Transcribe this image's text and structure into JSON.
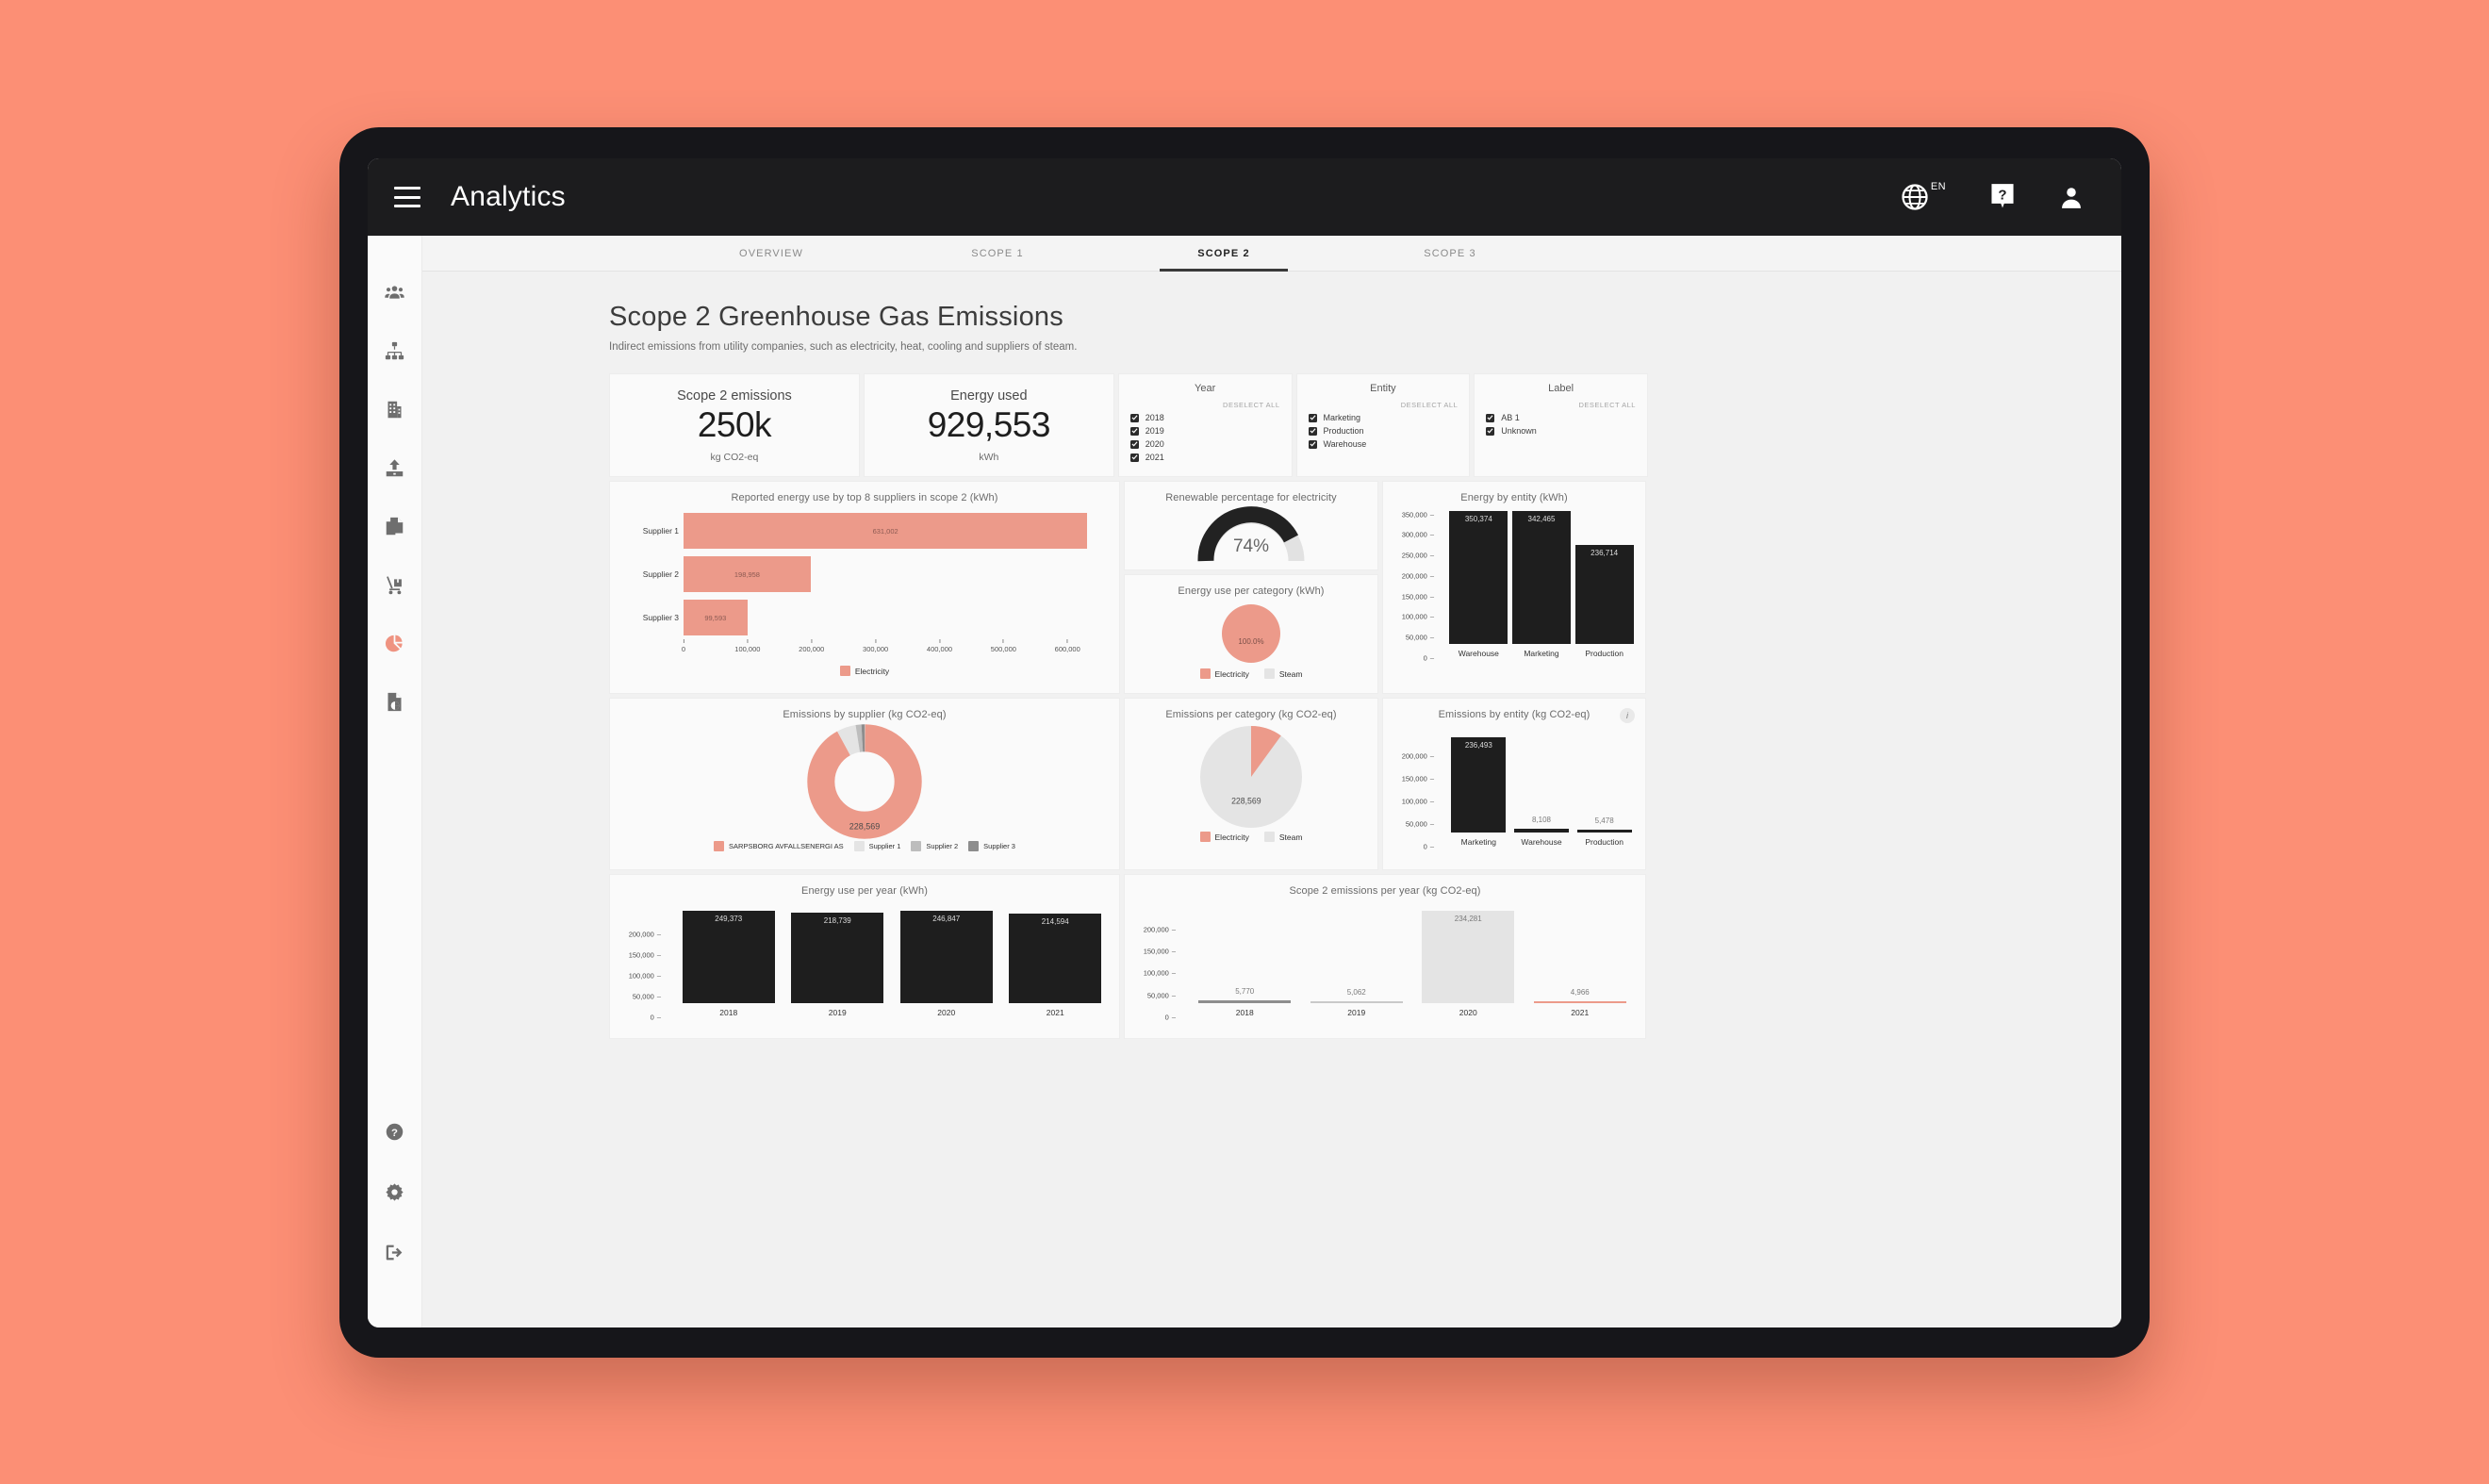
{
  "header": {
    "app_title": "Analytics",
    "lang_code": "EN",
    "menu_icon": "hamburger-icon",
    "globe_icon": "globe-icon",
    "help_icon": "help-bubble-icon",
    "account_icon": "user-avatar-icon"
  },
  "tabs": [
    {
      "label": "OVERVIEW",
      "active": false
    },
    {
      "label": "SCOPE 1",
      "active": false
    },
    {
      "label": "SCOPE 2",
      "active": true
    },
    {
      "label": "SCOPE 3",
      "active": false
    }
  ],
  "sidebar": {
    "top_items": [
      {
        "icon": "people-group-icon",
        "active": false
      },
      {
        "icon": "sitemap-icon",
        "active": false
      },
      {
        "icon": "building-icon",
        "active": false
      },
      {
        "icon": "upload-icon",
        "active": false
      },
      {
        "icon": "copy-documents-icon",
        "active": false
      },
      {
        "icon": "hand-truck-icon",
        "active": false
      },
      {
        "icon": "pie-chart-icon",
        "active": true
      },
      {
        "icon": "file-chart-icon",
        "active": false
      }
    ],
    "bottom_items": [
      {
        "icon": "question-circle-icon"
      },
      {
        "icon": "gear-icon"
      },
      {
        "icon": "sign-out-icon"
      }
    ]
  },
  "page": {
    "title": "Scope 2 Greenhouse Gas Emissions",
    "subtitle": "Indirect emissions from utility companies, such as electricity, heat, cooling and suppliers of steam."
  },
  "kpis": [
    {
      "label": "Scope 2 emissions",
      "value": "250k",
      "unit": "kg CO2-eq"
    },
    {
      "label": "Energy used",
      "value": "929,553",
      "unit": "kWh"
    }
  ],
  "filters": [
    {
      "title": "Year",
      "deselect": "DESELECT ALL",
      "options": [
        {
          "label": "2018",
          "checked": true
        },
        {
          "label": "2019",
          "checked": true
        },
        {
          "label": "2020",
          "checked": true
        },
        {
          "label": "2021",
          "checked": true
        }
      ]
    },
    {
      "title": "Entity",
      "deselect": "DESELECT ALL",
      "options": [
        {
          "label": "Marketing",
          "checked": true
        },
        {
          "label": "Production",
          "checked": true
        },
        {
          "label": "Warehouse",
          "checked": true
        }
      ]
    },
    {
      "title": "Label",
      "deselect": "DESELECT ALL",
      "options": [
        {
          "label": "AB 1",
          "checked": true
        },
        {
          "label": "Unknown",
          "checked": true
        }
      ]
    }
  ],
  "colors": {
    "coral": "#ec9a8a",
    "dark": "#1e1e1e",
    "light_grey": "#e4e4e4",
    "mid_grey": "#bdbdbd",
    "dark_grey": "#8d8d8d",
    "page_bg": "#fc8f75"
  },
  "chart_data": [
    {
      "id": "supplier-energy",
      "type": "bar",
      "orientation": "horizontal",
      "title": "Reported energy use by top 8 suppliers in scope 2 (kWh)",
      "categories": [
        "Supplier 1",
        "Supplier 2",
        "Supplier 3"
      ],
      "values": [
        631002,
        198958,
        99593
      ],
      "labels": [
        "631,002",
        "198,958",
        "99,593"
      ],
      "xlim": [
        0,
        660000
      ],
      "xticks": [
        0,
        100000,
        200000,
        300000,
        400000,
        500000,
        600000
      ],
      "xtick_labels": [
        "0",
        "100,000",
        "200,000",
        "300,000",
        "400,000",
        "500,000",
        "600,000"
      ],
      "legend": [
        {
          "name": "Electricity",
          "color": "#ec9a8a"
        }
      ],
      "grid": false
    },
    {
      "id": "renewable-gauge",
      "type": "gauge",
      "title": "Renewable percentage for electricity",
      "value": 74,
      "value_label": "74%",
      "max": 100,
      "fill_color": "#222222",
      "track_color": "#e2e2e2"
    },
    {
      "id": "energy-by-entity",
      "type": "bar",
      "orientation": "vertical",
      "title": "Energy by entity (kWh)",
      "categories": [
        "Warehouse",
        "Marketing",
        "Production"
      ],
      "values": [
        350374,
        342465,
        236714
      ],
      "labels": [
        "350,374",
        "342,465",
        "236,714"
      ],
      "ylim": [
        0,
        358000
      ],
      "yticks": [
        0,
        50000,
        100000,
        150000,
        200000,
        250000,
        300000,
        350000
      ],
      "ytick_labels": [
        "0",
        "50,000",
        "100,000",
        "150,000",
        "200,000",
        "250,000",
        "300,000",
        "350,000"
      ],
      "bar_color": "#1e1e1e",
      "grid": false
    },
    {
      "id": "energy-per-category",
      "type": "pie",
      "title": "Energy use per category (kWh)",
      "slices": [
        {
          "name": "Electricity",
          "value": 100.0,
          "label": "100.0%",
          "color": "#ec9a8a"
        },
        {
          "name": "Steam",
          "value": 0.0,
          "label": "",
          "color": "#e4e4e4"
        }
      ],
      "legend_position": "bottom"
    },
    {
      "id": "emissions-by-supplier",
      "type": "pie",
      "variant": "donut",
      "title": "Emissions by  supplier (kg CO2-eq)",
      "center_label": "228,569",
      "slices": [
        {
          "name": "SARPSBORG AVFALLSENERGI AS",
          "value": 92.0,
          "color": "#ec9a8a"
        },
        {
          "name": "Supplier 1",
          "value": 5.4,
          "color": "#e4e4e4"
        },
        {
          "name": "Supplier 2",
          "value": 1.6,
          "color": "#bdbdbd"
        },
        {
          "name": "Supplier 3",
          "value": 1.0,
          "color": "#8d8d8d"
        }
      ],
      "legend_position": "bottom"
    },
    {
      "id": "emissions-per-category",
      "type": "pie",
      "title": "Emissions per category (kg CO2-eq)",
      "center_label": "228,569",
      "slices": [
        {
          "name": "Electricity",
          "value": 9.0,
          "color": "#ec9a8a"
        },
        {
          "name": "Steam",
          "value": 91.0,
          "color": "#e4e4e4"
        }
      ],
      "legend_position": "bottom"
    },
    {
      "id": "emissions-by-entity",
      "type": "bar",
      "orientation": "vertical",
      "title": "Emissions by entity (kg CO2-eq)",
      "info_icon": "info-icon",
      "categories": [
        "Marketing",
        "Warehouse",
        "Production"
      ],
      "values": [
        236493,
        8108,
        5478
      ],
      "labels": [
        "236,493",
        "8,108",
        "5,478"
      ],
      "ylim": [
        0,
        242000
      ],
      "yticks": [
        0,
        50000,
        100000,
        150000,
        200000
      ],
      "ytick_labels": [
        "0",
        "50,000",
        "100,000",
        "150,000",
        "200,000"
      ],
      "bar_color": "#1e1e1e",
      "grid": false
    },
    {
      "id": "energy-use-per-year",
      "type": "bar",
      "orientation": "vertical",
      "title": "Energy use per year (kWh)",
      "categories": [
        "2018",
        "2019",
        "2020",
        "2021"
      ],
      "values": [
        249373,
        218739,
        246847,
        214594
      ],
      "labels": [
        "249,373",
        "218,739",
        "246,847",
        "214,594"
      ],
      "ylim": [
        0,
        256000
      ],
      "yticks": [
        0,
        50000,
        100000,
        150000,
        200000
      ],
      "ytick_labels": [
        "0",
        "50,000",
        "100,000",
        "150,000",
        "200,000"
      ],
      "bar_color": "#1e1e1e",
      "grid": false
    },
    {
      "id": "scope2-emissions-per-year",
      "type": "bar",
      "orientation": "vertical",
      "title": "Scope 2 emissions per year (kg CO2-eq)",
      "categories": [
        "2018",
        "2019",
        "2020",
        "2021"
      ],
      "values": [
        5770,
        5062,
        234281,
        4966
      ],
      "labels": [
        "5,770",
        "5,062",
        "234,281",
        "4,966"
      ],
      "bar_colors": [
        "#8d8d8d",
        "#c9c9c9",
        "#e4e4e4",
        "#ec9a8a"
      ],
      "ylim": [
        0,
        242000
      ],
      "yticks": [
        0,
        50000,
        100000,
        150000,
        200000
      ],
      "ytick_labels": [
        "0",
        "50,000",
        "100,000",
        "150,000",
        "200,000"
      ],
      "grid": false
    }
  ]
}
